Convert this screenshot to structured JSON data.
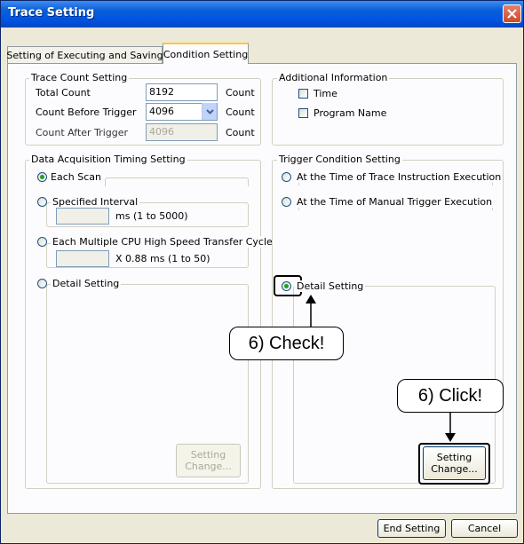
{
  "window": {
    "title": "Trace Setting",
    "close_icon": "close-icon"
  },
  "tabs": [
    {
      "label": "Setting of Executing and Saving",
      "active": false
    },
    {
      "label": "Condition Setting",
      "active": true
    }
  ],
  "trace_count": {
    "title": "Trace Count Setting",
    "total_count_label": "Total Count",
    "total_count_value": "8192",
    "count_before_label": "Count Before Trigger",
    "count_before_value": "4096",
    "count_after_label": "Count After Trigger",
    "count_after_value": "4096",
    "unit": "Count"
  },
  "additional_info": {
    "title": "Additional Information",
    "time_label": "Time",
    "program_name_label": "Program Name"
  },
  "data_acquisition": {
    "title": "Data Acquisition Timing Setting",
    "each_scan": "Each Scan",
    "specified_interval": "Specified Interval",
    "interval_range": "ms (1 to 5000)",
    "multiple_cpu": "Each Multiple CPU High Speed Transfer Cycle",
    "cycle_range": "X 0.88 ms (1 to 50)",
    "detail_setting": "Detail Setting",
    "setting_change": "Setting Change..."
  },
  "trigger_condition": {
    "title": "Trigger Condition Setting",
    "trace_instruction": "At the Time of Trace Instruction Execution",
    "manual_trigger": "At the Time of Manual Trigger Execution",
    "detail_setting": "Detail Setting",
    "setting_change": "Setting Change..."
  },
  "callouts": {
    "check": "6) Check!",
    "click": "6) Click!"
  },
  "footer": {
    "end_setting": "End Setting",
    "cancel": "Cancel"
  },
  "colors": {
    "titlebar": "#0054e3",
    "panel": "#fcfcfe",
    "dialog": "#ece9d8",
    "radio_on": "#21a121"
  }
}
